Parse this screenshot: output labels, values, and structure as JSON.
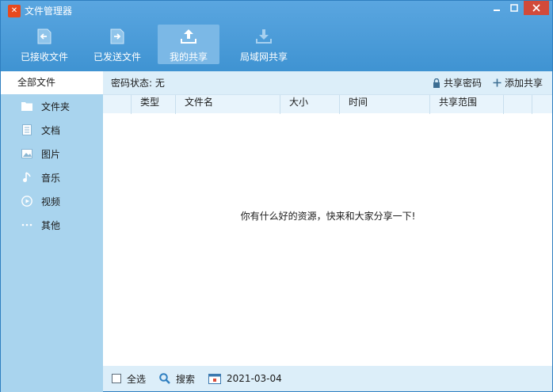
{
  "window": {
    "title": "文件管理器"
  },
  "toolbar": {
    "items": [
      {
        "label": "已接收文件",
        "icon": "received-file-icon"
      },
      {
        "label": "已发送文件",
        "icon": "sent-file-icon"
      },
      {
        "label": "我的共享",
        "icon": "upload-share-icon",
        "active": true
      },
      {
        "label": "局域网共享",
        "icon": "download-lan-icon"
      }
    ]
  },
  "sidebar": {
    "all_label": "全部文件",
    "items": [
      {
        "label": "文件夹",
        "icon": "folder-icon"
      },
      {
        "label": "文档",
        "icon": "document-icon"
      },
      {
        "label": "图片",
        "icon": "image-icon"
      },
      {
        "label": "音乐",
        "icon": "music-icon"
      },
      {
        "label": "视频",
        "icon": "video-icon"
      },
      {
        "label": "其他",
        "icon": "more-icon"
      }
    ]
  },
  "status": {
    "password_state": "密码状态: 无",
    "share_password": "共享密码",
    "add_share": "添加共享"
  },
  "table": {
    "columns": [
      "类型",
      "文件名",
      "大小",
      "时间",
      "共享范围"
    ]
  },
  "empty_message": "你有什么好的资源，快来和大家分享一下!",
  "footer": {
    "select_all": "全选",
    "search": "搜索",
    "date": "2021-03-04"
  },
  "colors": {
    "accent": "#3f93d2",
    "sidebar": "#a9d4ee",
    "header_bg": "#dceef9"
  }
}
